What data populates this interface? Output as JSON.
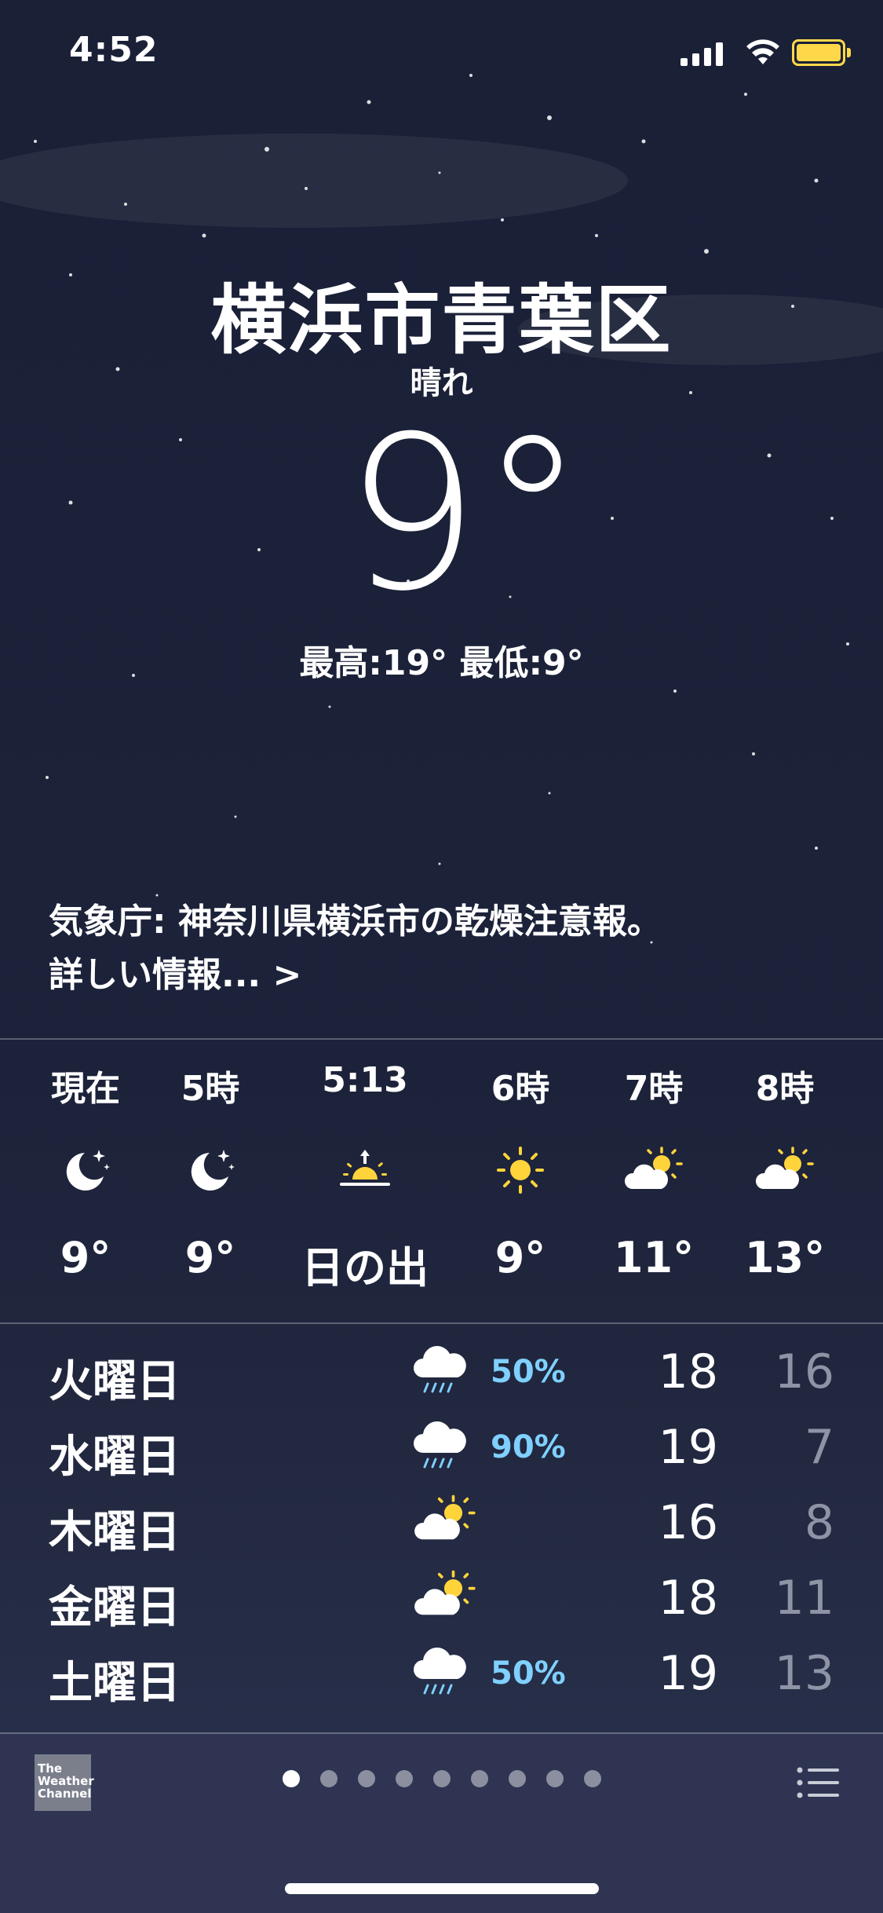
{
  "status_bar": {
    "time": "4:52"
  },
  "location": {
    "city": "横浜市青葉区",
    "condition": "晴れ",
    "temperature": "9°",
    "hi_lo": "最高:19° 最低:9°"
  },
  "alert": {
    "text": "気象庁: 神奈川県横浜市の乾燥注意報。",
    "more": "詳しい情報... >"
  },
  "hourly": [
    {
      "label": "現在",
      "icon": "moon-stars-icon",
      "value": "9°"
    },
    {
      "label": "5時",
      "icon": "moon-stars-icon",
      "value": "9°"
    },
    {
      "label": "5:13",
      "icon": "sunrise-icon",
      "value": "日の出"
    },
    {
      "label": "6時",
      "icon": "sun-icon",
      "value": "9°"
    },
    {
      "label": "7時",
      "icon": "partly-cloudy-icon",
      "value": "11°"
    },
    {
      "label": "8時",
      "icon": "partly-cloudy-icon",
      "value": "13°"
    }
  ],
  "daily": [
    {
      "day": "火曜日",
      "icon": "rain-icon",
      "precip": "50%",
      "high": "18",
      "low": "16"
    },
    {
      "day": "水曜日",
      "icon": "rain-icon",
      "precip": "90%",
      "high": "19",
      "low": "7"
    },
    {
      "day": "木曜日",
      "icon": "partly-cloudy-icon",
      "precip": "",
      "high": "16",
      "low": "8"
    },
    {
      "day": "金曜日",
      "icon": "partly-cloudy-icon",
      "precip": "",
      "high": "18",
      "low": "11"
    },
    {
      "day": "土曜日",
      "icon": "rain-icon",
      "precip": "50%",
      "high": "19",
      "low": "13"
    }
  ],
  "footer": {
    "logo_text": "The Weather Channel",
    "page_count": 9,
    "active_page": 1
  },
  "colors": {
    "precip": "#7fd0ff",
    "sun": "#ffd43b",
    "low_temp": "#8e93a6",
    "battery": "#ffd84a"
  }
}
